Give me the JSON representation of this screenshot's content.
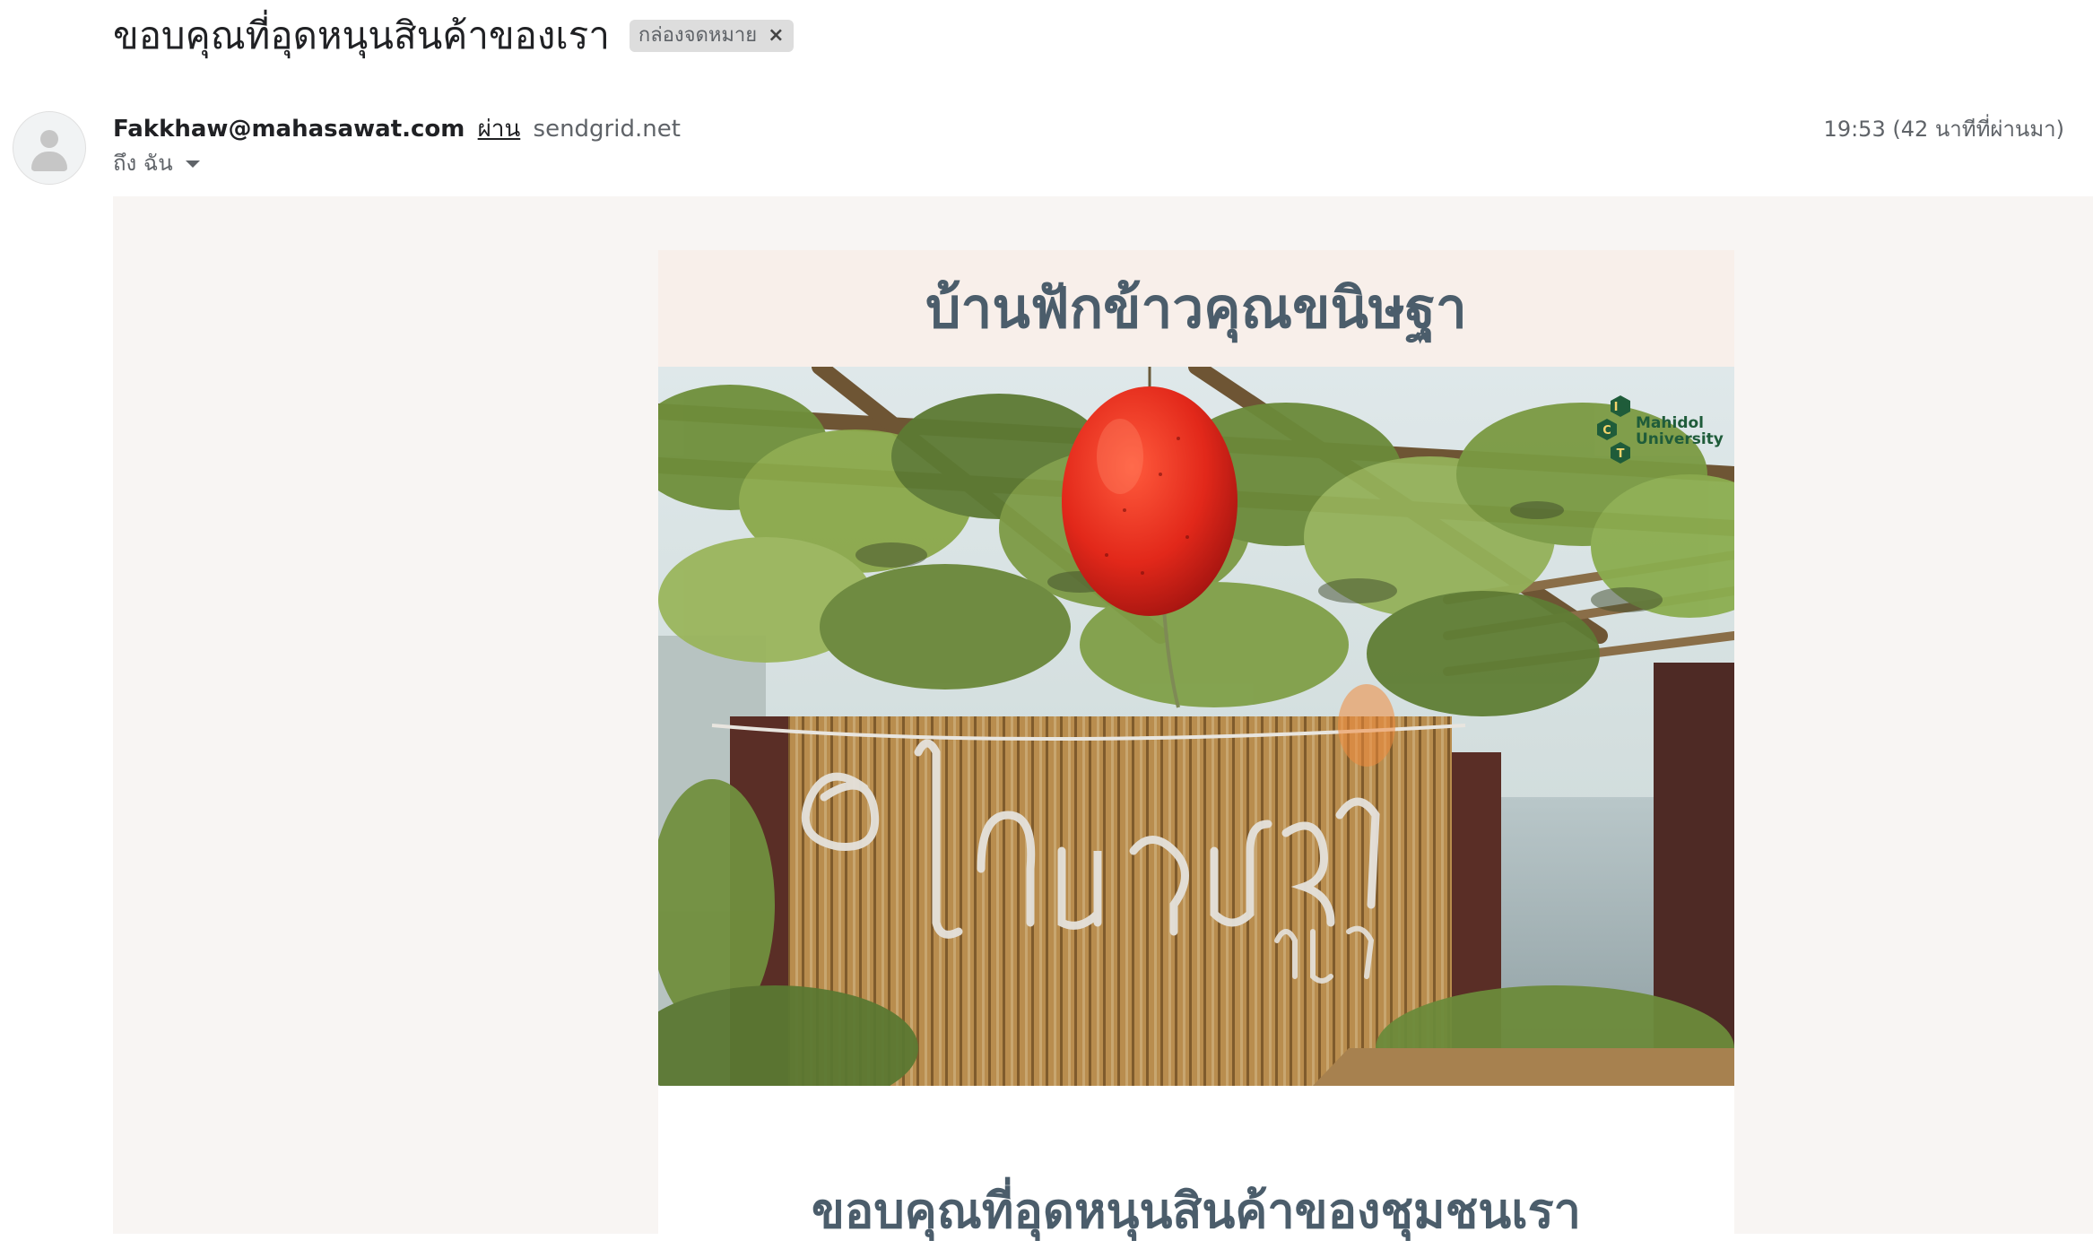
{
  "email": {
    "subject": "ขอบคุณที่อุดหนุนสินค้าของเรา",
    "label": "กล่องจดหมาย",
    "label_close": "×",
    "sender": "Fakkhaw@mahasawat.com",
    "via_label": "ผ่าน",
    "via_domain": "sendgrid.net",
    "recipient": "ถึง ฉัน",
    "time": "19:53 (42 นาทีที่ผ่านมา)"
  },
  "body": {
    "brand_title": "บ้านฟักข้าวคุณขนิษฐา",
    "hero_sign_text": "บ้านฟักข้าว ขนิษฐา",
    "logo_text_line1": "Mahidol",
    "logo_text_line2": "University",
    "logo_letters": [
      "I",
      "C",
      "T"
    ],
    "heading": "ขอบคุณที่อุดหนุนสินค้าของชุมชนเรา"
  },
  "icons": {
    "avatar": "person-placeholder-icon",
    "dropdown": "caret-down-icon",
    "remove_label": "close-icon"
  },
  "colors": {
    "canvas_bg": "#f8f5f3",
    "header_bg": "#f8efea",
    "title_text": "#4b5d6b",
    "chip_bg": "#dddddd"
  }
}
